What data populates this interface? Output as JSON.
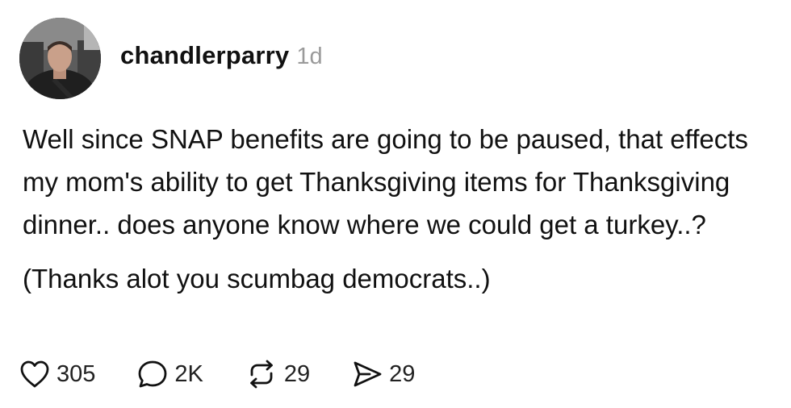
{
  "post": {
    "username": "chandlerparry",
    "timestamp": "1d",
    "paragraphs": [
      "Well since SNAP benefits are going to be paused, that effects my mom's ability to get Thanksgiving items for Thanksgiving dinner.. does anyone know where we could get a turkey..?",
      "(Thanks alot you scumbag democrats..)"
    ],
    "avatar_icon": "profile-photo"
  },
  "actions": {
    "like": {
      "icon": "heart-icon",
      "count": "305"
    },
    "reply": {
      "icon": "speech-bubble-icon",
      "count": "2K"
    },
    "repost": {
      "icon": "repost-icon",
      "count": "29"
    },
    "share": {
      "icon": "send-icon",
      "count": "29"
    }
  },
  "colors": {
    "text": "#111111",
    "muted": "#9a9a9a",
    "background": "#ffffff"
  }
}
